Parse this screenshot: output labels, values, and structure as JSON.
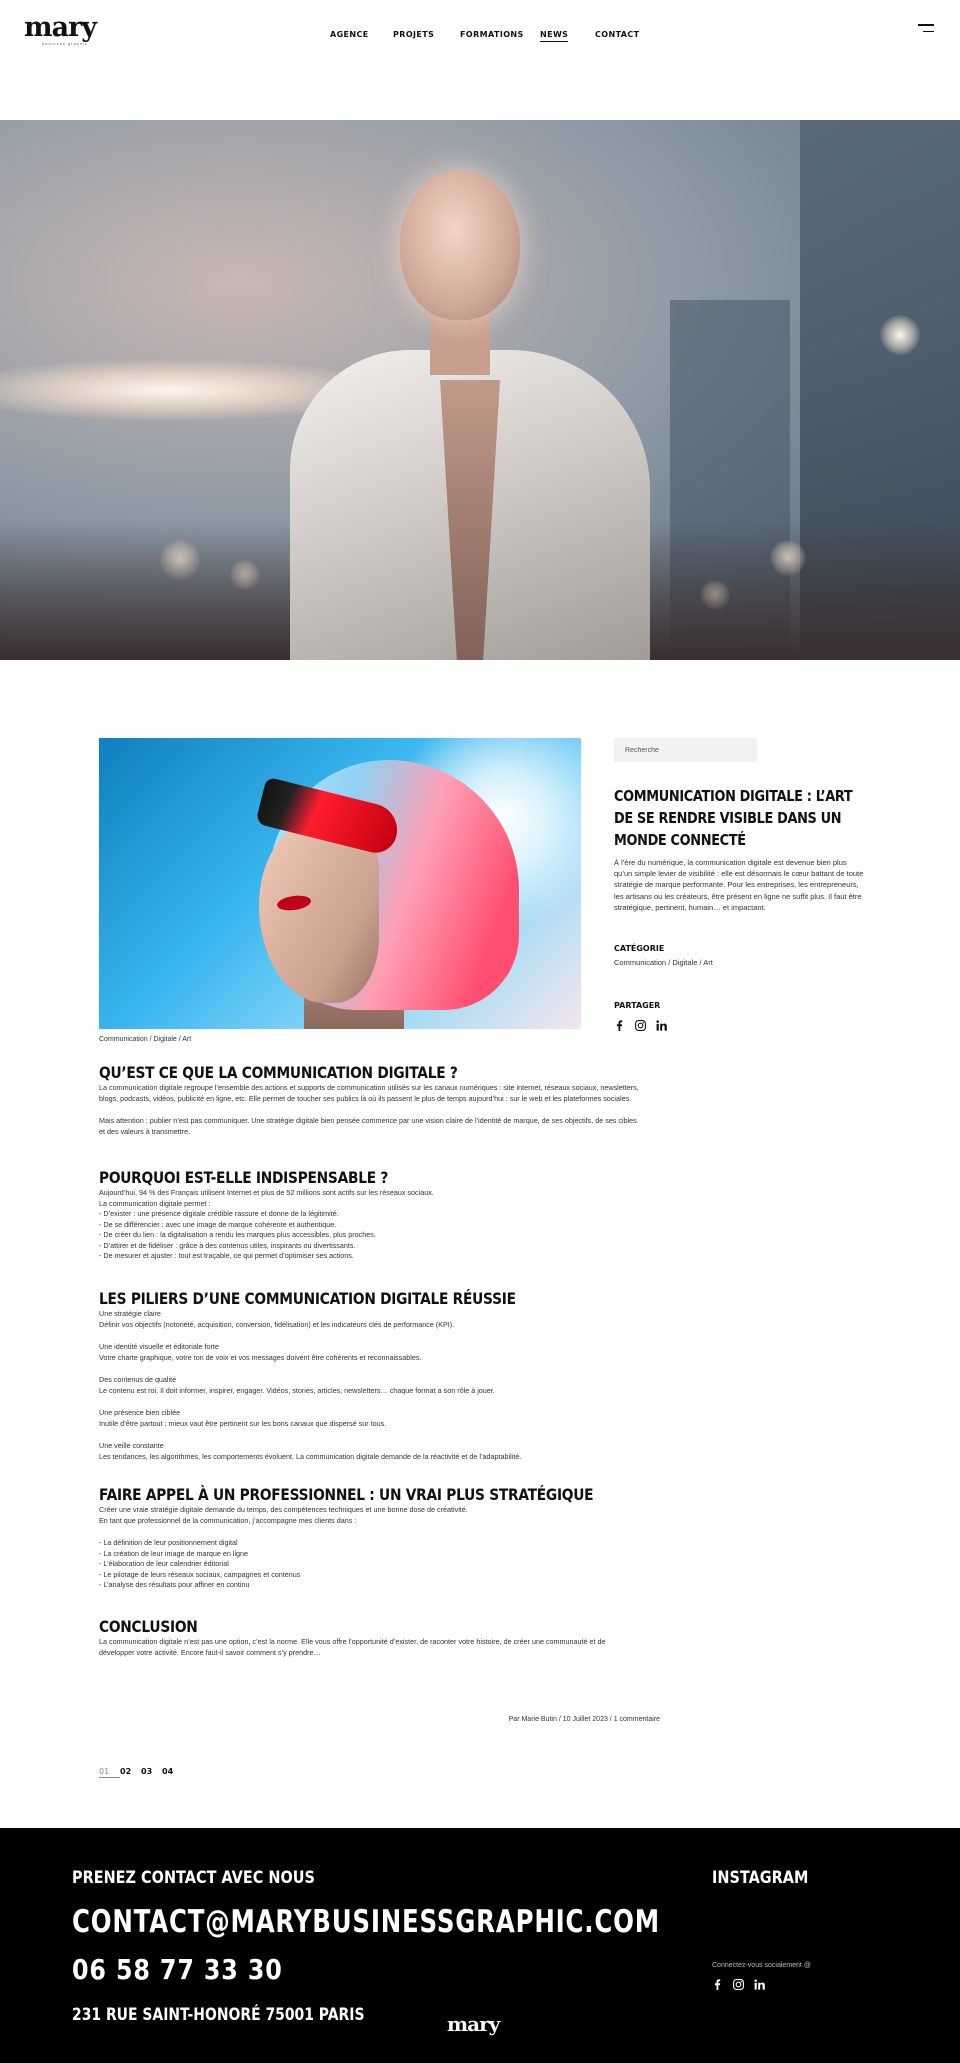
{
  "brand": {
    "logo": "mary",
    "logo_tagline": "business graphic"
  },
  "nav": {
    "items": [
      "AGENCE",
      "PROJETS",
      "FORMATIONS",
      "NEWS",
      "CONTACT"
    ],
    "active": "NEWS"
  },
  "article": {
    "image_caption": "Communication / Digitale / Art",
    "sections": [
      {
        "heading": "QU’EST CE QUE LA COMMUNICATION DIGITALE ?",
        "paragraphs": [
          "La communication digitale regroupe l’ensemble des actions et supports de communication utilisés sur les canaux numériques : site internet, réseaux sociaux, newsletters,\nblogs, podcasts, vidéos, publicité en ligne, etc. Elle permet de toucher ses publics là où ils passent le plus de temps aujourd’hui : sur le web et les plateformes sociales.",
          "Mais attention : publier n’est pas communiquer. Une stratégie digitale bien pensée commence par une vision claire de l’identité de marque, de ses objectifs, de ses cibles\net des valeurs à transmettre."
        ]
      },
      {
        "heading": "POURQUOI EST-ELLE INDISPENSABLE ?",
        "paragraphs": [
          "Aujourd’hui, 94 % des Français utilisent Internet et plus de 52 millions sont actifs sur les réseaux sociaux.\nLa communication digitale permet :\n- D’exister : une présence digitale crédible rassure et donne de la légitimité.\n- De se différencier : avec une image de marque cohérente et authentique.\n- De créer du lien : la digitalisation a rendu les marques plus accessibles, plus proches.\n- D’attirer et de fidéliser : grâce à des contenus utiles, inspirants ou divertissants.\n- De mesurer et ajuster : tout est traçable, ce qui permet d’optimiser ses actions."
        ]
      },
      {
        "heading": "LES PILIERS D’UNE COMMUNICATION DIGITALE RÉUSSIE",
        "paragraphs": [
          "Une stratégie claire\nDéfinir vos objectifs (notoriété, acquisition, conversion, fidélisation) et les indicateurs clés de performance (KPI).",
          "Une identité visuelle et éditoriale forte\nVotre charte graphique, votre ton de voix et vos messages doivent être cohérents et reconnaissables.",
          "Des contenus de qualité\nLe contenu est roi. Il doit informer, inspirer, engager. Vidéos, stories, articles, newsletters… chaque format a son rôle à jouer.",
          "Une présence bien ciblée\nInutile d’être partout : mieux vaut être pertinent sur les bons canaux que dispersé sur tous.",
          "Une veille constante\nLes tendances, les algorithmes, les comportements évoluent. La communication digitale demande de la réactivité et de l’adaptabilité."
        ]
      },
      {
        "heading": "FAIRE APPEL À UN PROFESSIONNEL : UN VRAI PLUS STRATÉGIQUE",
        "paragraphs": [
          "Créer une vraie stratégie digitale demande du temps, des compétences techniques et une bonne dose de créativité.\nEn tant que professionnel de la communication, j’accompagne mes clients dans :",
          "- La définition de leur positionnement digital\n- La création de leur image de marque en ligne\n- L’élaboration de leur calendrier éditorial\n- Le pilotage de leurs réseaux sociaux, campagnes et contenus\n- L’analyse des résultats pour affiner en continu"
        ]
      },
      {
        "heading": "CONCLUSION",
        "paragraphs": [
          "La communication digitale n’est pas une option, c’est la norme. Elle vous offre l’opportunité d’exister, de raconter votre histoire, de créer une communauté et de\ndévelopper votre activité. Encore faut-il savoir comment s’y prendre…"
        ]
      }
    ],
    "byline": "Par Marie Butin / 10 Juillet 2023 / 1 commentaire"
  },
  "sidebar": {
    "search_placeholder": "Recherche",
    "title": "COMMUNICATION DIGITALE : L’ART DE SE RENDRE VISIBLE DANS UN MONDE CONNECTÉ",
    "excerpt": "À l’ère du numérique, la communication digitale est devenue bien plus qu’un simple levier de visibilité : elle est désormais le cœur battant de toute stratégie de marque performante. Pour les entreprises, les entrepreneurs, les artisans ou les créateurs, être présent en ligne ne suffit plus. Il faut être stratégique, pertinent, humain… et impactant.",
    "category_label": "CATÉGORIE",
    "category_value": "Communication / Digitale / Art",
    "share_label": "PARTAGER",
    "share_icons": [
      "facebook-icon",
      "instagram-icon",
      "linkedin-icon"
    ]
  },
  "pagination": {
    "pages": [
      "01",
      "02",
      "03",
      "04"
    ],
    "active": "01"
  },
  "footer": {
    "contact_title": "PRENEZ CONTACT AVEC NOUS",
    "email": "CONTACT@MARYBUSINESSGRAPHIC.COM",
    "phone": "06 58 77 33 30",
    "address": "231 RUE SAINT-HONORÉ 75001 PARIS",
    "instagram_title": "INSTAGRAM",
    "connect_text": "Connectez-vous socialement @",
    "logo": "mary"
  },
  "colors": {
    "footer_bg": "#000000",
    "search_bg": "#f2f2f2",
    "text": "#111111"
  }
}
